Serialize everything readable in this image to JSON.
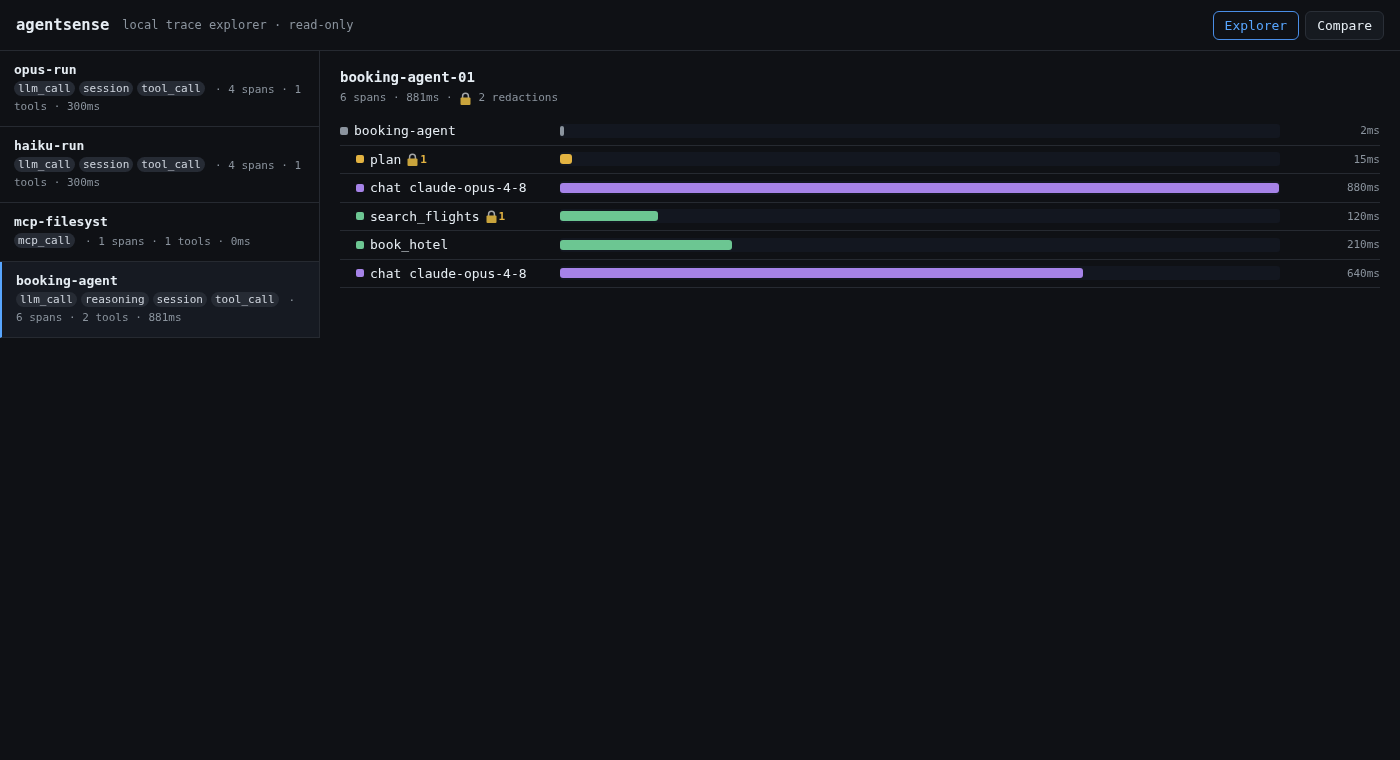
{
  "app": {
    "name": "agentsense",
    "tagline": "local trace explorer · read-only"
  },
  "nav": [
    {
      "label": "Explorer",
      "selected": true
    },
    {
      "label": "Compare",
      "selected": false
    }
  ],
  "traces": [
    {
      "name": "opus-run",
      "tags": [
        "llm_call",
        "session",
        "tool_call"
      ],
      "stats": [
        "· 4 spans · 1",
        "tools · 300ms"
      ],
      "selected": false
    },
    {
      "name": "haiku-run",
      "tags": [
        "llm_call",
        "session",
        "tool_call"
      ],
      "stats": [
        "· 4 spans · 1",
        "tools · 300ms"
      ],
      "selected": false
    },
    {
      "name": "mcp-filesyst",
      "tags": [
        "mcp_call"
      ],
      "stats": [
        "· 1 spans · 1 tools · 0ms"
      ],
      "selected": false
    },
    {
      "name": "booking-agent",
      "tags": [
        "llm_call",
        "reasoning",
        "session",
        "tool_call"
      ],
      "stats": [
        "·",
        "6 spans · 2 tools · 881ms"
      ],
      "selected": true
    }
  ],
  "trace": {
    "title": "booking-agent-01",
    "summary": "6 spans · 881ms ·",
    "redactions": "2 redactions",
    "spans": [
      {
        "name": "booking-agent",
        "color": "#8b949e",
        "level": 0.0023,
        "duration": "2ms",
        "children": [
          {
            "name": "plan",
            "color": "#e3b341",
            "redactions": "1",
            "level": 0.017,
            "duration": "15ms"
          },
          {
            "name": "chat claude-opus-4-8",
            "color": "#a683e8",
            "level": 0.9989,
            "duration": "880ms"
          },
          {
            "name": "search_flights",
            "color": "#6cc692",
            "redactions": "1",
            "level": 0.1362,
            "duration": "120ms"
          },
          {
            "name": "book_hotel",
            "color": "#6cc692",
            "level": 0.2384,
            "duration": "210ms"
          },
          {
            "name": "chat claude-opus-4-8",
            "color": "#a683e8",
            "level": 0.7264,
            "duration": "640ms"
          }
        ]
      }
    ]
  }
}
